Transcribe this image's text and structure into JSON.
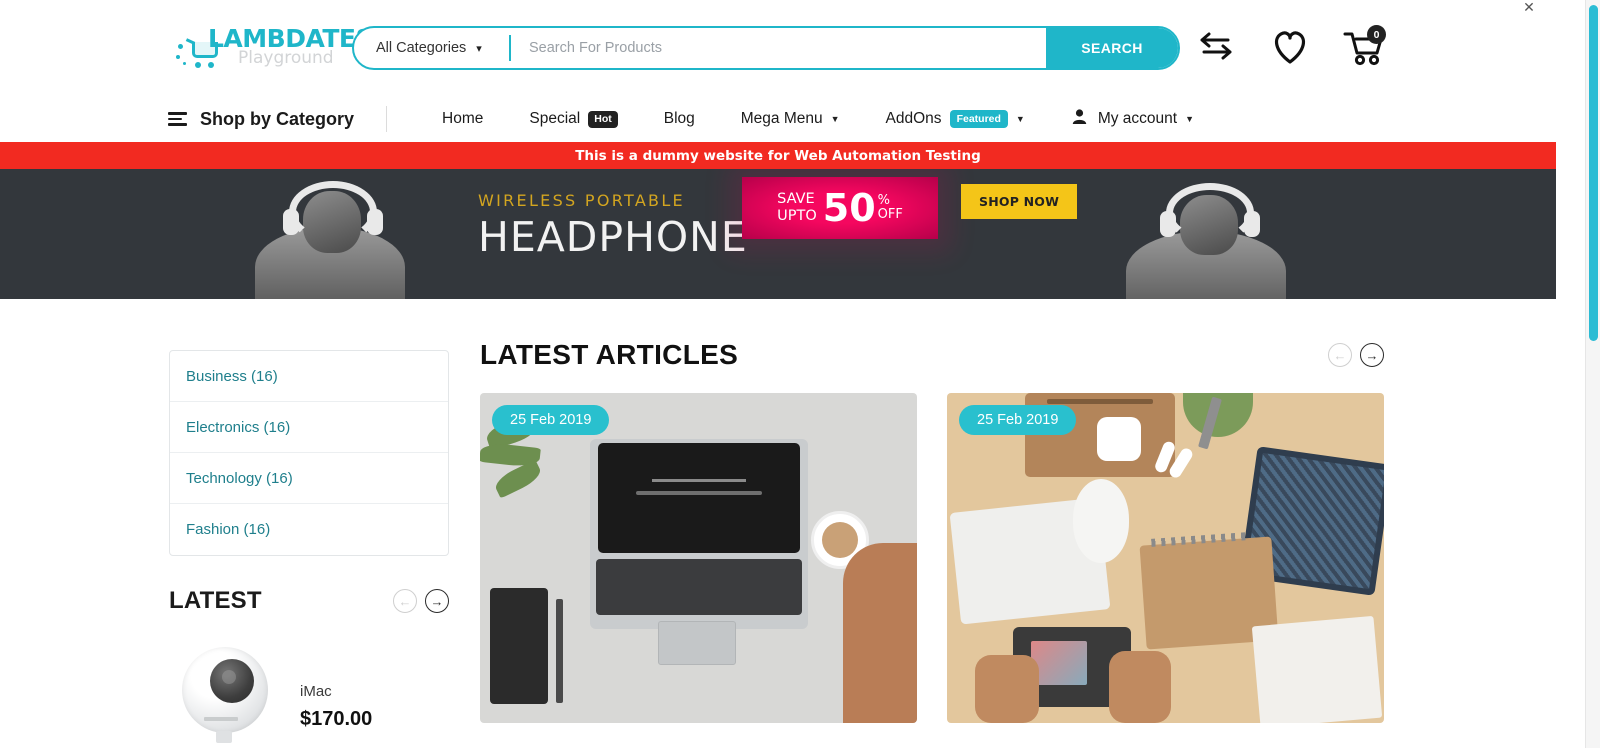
{
  "window": {
    "close_label": "✕"
  },
  "header": {
    "logo": {
      "word": "LAMBDATEST",
      "sub": "Playground",
      "icon": "shopping-cart-logo-icon"
    },
    "search": {
      "category_label": "All Categories",
      "placeholder": "Search For Products",
      "value": "",
      "button_label": "SEARCH"
    },
    "icons": [
      {
        "name": "compare-arrows-icon",
        "label": "Compare"
      },
      {
        "name": "heart-icon",
        "label": "Wishlist"
      },
      {
        "name": "cart-icon",
        "label": "Cart"
      }
    ],
    "cart_count": "0"
  },
  "nav": {
    "shop_by_category": "Shop by Category",
    "items": [
      {
        "label": "Home",
        "badge": null,
        "badge_type": null,
        "caret": false
      },
      {
        "label": "Special",
        "badge": "Hot",
        "badge_type": "hot",
        "caret": false
      },
      {
        "label": "Blog",
        "badge": null,
        "badge_type": null,
        "caret": false
      },
      {
        "label": "Mega Menu",
        "badge": null,
        "badge_type": null,
        "caret": true
      },
      {
        "label": "AddOns",
        "badge": "Featured",
        "badge_type": "featured",
        "caret": true
      },
      {
        "label": "My account",
        "badge": null,
        "badge_type": null,
        "caret": true,
        "icon": "person-icon"
      }
    ]
  },
  "notice": {
    "text": "This is a dummy website for Web Automation Testing",
    "bg": "#f22a21"
  },
  "hero": {
    "kicker": "WIRELESS PORTABLE",
    "title": "HEADPHONE",
    "promo_save": "SAVE",
    "promo_upto": "UPTO",
    "promo_amount": "50",
    "promo_percent": "%",
    "promo_off": "OFF",
    "cta": "SHOP NOW",
    "bg": "#33373c",
    "promo_bg": "#f5075f",
    "cta_bg": "#f4c518"
  },
  "sidebar": {
    "categories": [
      {
        "label": "Business (16)"
      },
      {
        "label": "Electronics (16)"
      },
      {
        "label": "Technology (16)"
      },
      {
        "label": "Fashion (16)"
      }
    ],
    "latest": {
      "title": "LATEST",
      "prev": "←",
      "next": "→",
      "product": {
        "name": "iMac",
        "price": "$170.00",
        "image": "security-camera-photo"
      }
    }
  },
  "articles": {
    "title": "LATEST ARTICLES",
    "prev": "←",
    "next": "→",
    "cards": [
      {
        "date": "25 Feb 2019",
        "image": "laptop-desk-coffee-photo"
      },
      {
        "date": "25 Feb 2019",
        "image": "desk-flatlay-camera-photo"
      }
    ],
    "badge_bg": "#29c0ce"
  },
  "scrollbar": {
    "color": "#2bbcd4"
  }
}
